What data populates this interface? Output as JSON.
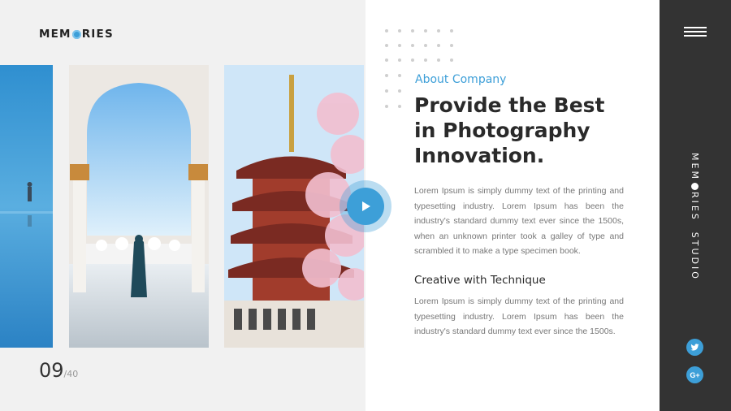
{
  "brand": {
    "logo_before": "MEM",
    "logo_after": "RIES",
    "accent": "#3d9fd8"
  },
  "slide": {
    "current": "09",
    "total": "/40"
  },
  "content": {
    "eyebrow": "About Company",
    "headline_line1": "Provide the Best",
    "headline_line2": "in Photography",
    "headline_line3": "Innovation.",
    "paragraph1": "Lorem Ipsum is simply dummy text of the printing and typesetting industry.  Lorem Ipsum has been the industry's standard dummy text ever since the 1500s, when an unknown printer took a galley of type and scrambled it to make a type specimen book.",
    "subheading": "Creative with Technique",
    "paragraph2": "Lorem Ipsum is simply dummy text of the printing and typesetting industry.  Lorem Ipsum has been the industry's standard dummy text ever since the 1500s."
  },
  "sidebar": {
    "vertical_before": "MEM",
    "vertical_after": "RIES  STUDIO",
    "icons": [
      "menu-icon",
      "twitter-icon",
      "google-plus-icon"
    ],
    "gplus_label": "G+",
    "background": "#333333"
  },
  "photos": [
    "lake-photo",
    "mosque-arch-photo",
    "pagoda-blossom-photo"
  ],
  "play_icon": "play-icon"
}
